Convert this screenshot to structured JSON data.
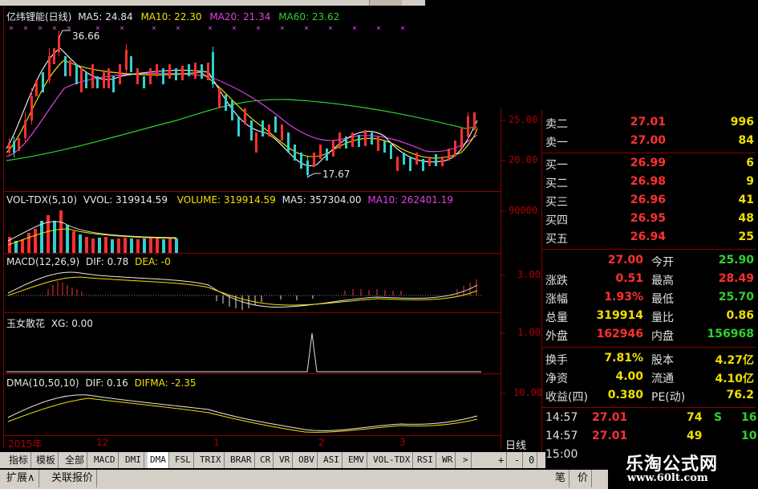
{
  "main_chart": {
    "title": "亿纬锂能(日线)",
    "ma5": "MA5: 24.84",
    "ma10": "MA10: 22.30",
    "ma20": "MA20: 21.34",
    "ma60": "MA60: 23.62",
    "high_mark": "36.66",
    "low_mark": "17.67",
    "y_ticks": [
      "25.00",
      "20.00"
    ]
  },
  "volume_panel": {
    "indicator": "VOL-TDX(5,10)",
    "vvol": "VVOL: 319914.59",
    "volume": "VOLUME: 319914.59",
    "ma5": "MA5: 357304.00",
    "ma10": "MA10: 262401.19",
    "y_tick": "90000"
  },
  "macd_panel": {
    "indicator": "MACD(12,26,9)",
    "dif": "DIF: 0.78",
    "dea": "DEA: -0",
    "y_tick": "3.00"
  },
  "xg_panel": {
    "indicator": "玉女散花",
    "xg": "XG: 0.00",
    "y_tick": "1.00"
  },
  "dma_panel": {
    "indicator": "DMA(10,50,10)",
    "dif": "DIF: 0.16",
    "difma": "DIFMA: -2.35",
    "y_tick": "10.00"
  },
  "time_axis": {
    "labels": [
      "2015年",
      "12",
      "1",
      "2",
      "3"
    ],
    "period": "日线"
  },
  "order_book": {
    "asks": [
      {
        "label": "卖二",
        "price": "27.01",
        "vol": "996"
      },
      {
        "label": "卖一",
        "price": "27.00",
        "vol": "84"
      }
    ],
    "bids": [
      {
        "label": "买一",
        "price": "26.99",
        "vol": "6"
      },
      {
        "label": "买二",
        "price": "26.98",
        "vol": "9"
      },
      {
        "label": "买三",
        "price": "26.96",
        "vol": "41"
      },
      {
        "label": "买四",
        "price": "26.95",
        "vol": "48"
      },
      {
        "label": "买五",
        "price": "26.94",
        "vol": "25"
      }
    ]
  },
  "quote": {
    "rows": [
      {
        "l1": "",
        "v1": "27.00",
        "l2": "今开",
        "v2": "25.90"
      },
      {
        "l1": "涨跌",
        "v1": "0.51",
        "l2": "最高",
        "v2": "28.49"
      },
      {
        "l1": "涨幅",
        "v1": "1.93%",
        "l2": "最低",
        "v2": "25.70"
      },
      {
        "l1": "总量",
        "v1": "319914",
        "l2": "量比",
        "v2": "0.86"
      },
      {
        "l1": "外盘",
        "v1": "162946",
        "l2": "内盘",
        "v2": "156968"
      },
      {
        "l1": "换手",
        "v1": "7.81%",
        "l2": "股本",
        "v2": "4.27亿"
      },
      {
        "l1": "净资",
        "v1": "4.00",
        "l2": "流通",
        "v2": "4.10亿"
      },
      {
        "l1": "收益(四)",
        "v1": "0.380",
        "l2": "PE(动)",
        "v2": "76.2"
      }
    ]
  },
  "ticks": [
    {
      "time": "14:57",
      "price": "27.01",
      "vol": "74",
      "dir": "S",
      "n": "16"
    },
    {
      "time": "14:57",
      "price": "27.01",
      "vol": "49",
      "dir": "",
      "n": "10"
    },
    {
      "time": "15:00",
      "price": "",
      "vol": "",
      "dir": "",
      "n": ""
    }
  ],
  "toolbar": {
    "items": [
      "指标",
      "模板",
      "全部",
      "MACD",
      "DMI",
      "DMA",
      "FSL",
      "TRIX",
      "BRAR",
      "CR",
      "VR",
      "OBV",
      "ASI",
      "EMV",
      "VOL-TDX",
      "RSI",
      "WR",
      ">"
    ],
    "controls": [
      "+",
      "-",
      "0"
    ]
  },
  "bottom_tabs": [
    "扩展∧",
    "关联报价"
  ],
  "bottom_right": [
    "笔",
    "价"
  ],
  "watermark": {
    "title": "乐淘公式网",
    "url": "www.60lt.com"
  },
  "colors": {
    "up": "#ff3030",
    "down": "#30d0d0",
    "ma5": "#e8e8e8",
    "ma10": "#f0e000",
    "ma20": "#e040e0",
    "ma60": "#30d030",
    "grid": "#8a0000"
  }
}
